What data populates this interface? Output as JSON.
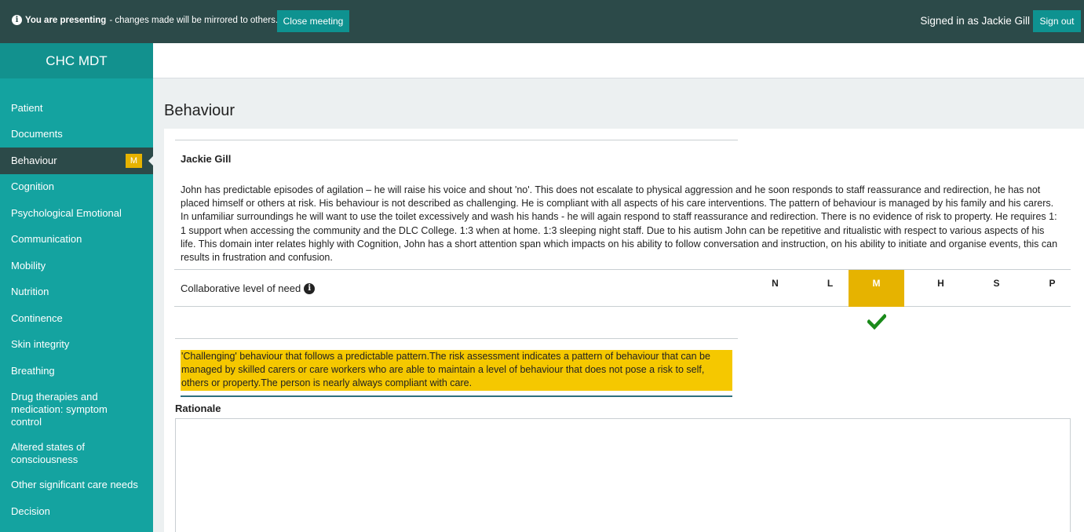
{
  "topbar": {
    "presenting_bold": "You are presenting",
    "presenting_rest": " - changes made will be mirrored to others.",
    "close_button": "Close meeting",
    "signed_in": "Signed in as Jackie Gill",
    "signout_button": "Sign out"
  },
  "sidebar": {
    "title": "CHC MDT",
    "items": [
      {
        "label": "Patient"
      },
      {
        "label": "Documents"
      },
      {
        "label": "Behaviour",
        "badge": "M"
      },
      {
        "label": "Cognition"
      },
      {
        "label": "Psychological Emotional"
      },
      {
        "label": "Communication"
      },
      {
        "label": "Mobility"
      },
      {
        "label": "Nutrition"
      },
      {
        "label": "Continence"
      },
      {
        "label": "Skin integrity"
      },
      {
        "label": "Breathing"
      },
      {
        "label": "Drug therapies and medication: symptom control"
      },
      {
        "label": "Altered states of consciousness"
      },
      {
        "label": "Other significant care needs"
      },
      {
        "label": "Decision"
      }
    ]
  },
  "main": {
    "title": "Behaviour",
    "author": "Jackie Gill",
    "description": "John has predictable episodes of agilation – he will raise his voice and shout 'no'. This does not escalate to physical aggression and he soon responds to staff reassurance and redirection, he has not placed himself or others at risk. His behaviour is not described as challenging. He is compliant with all aspects of his care interventions. The pattern of behaviour is managed by his family and his carers. In unfamiliar surroundings he will want to use the toilet excessively and wash his hands - he will again respond to staff reassurance and redirection. There is no evidence of risk to property. He requires 1: 1 support when accessing the community and the DLC College. 1:3 when at home. 1:3 sleeping night staff. Due to his autism John can be repetitive and ritualistic with respect to various aspects of his life. This domain inter relates highly with Cognition, John has a short attention span which impacts on his ability to follow conversation and instruction, on his ability to initiate and organise events, this can results in frustration and confusion.",
    "need_label": "Collaborative level of need",
    "levels": [
      "N",
      "L",
      "M",
      "H",
      "S",
      "P"
    ],
    "selected_level": "M",
    "level_description": "'Challenging' behaviour that follows a predictable pattern.The risk assessment indicates a pattern of behaviour that can be managed by skilled carers or care workers who are able to maintain a level of behaviour that does not pose a risk to self, others or property.The person is nearly always compliant with care.",
    "rationale_label": "Rationale",
    "rationale_value": ""
  },
  "colors": {
    "topbar": "#2c4a49",
    "sidebar": "#14a3a0",
    "accent": "#0e9290",
    "level_selected": "#e6b300",
    "highlight": "#f5c800",
    "check": "#1a8a1a"
  }
}
